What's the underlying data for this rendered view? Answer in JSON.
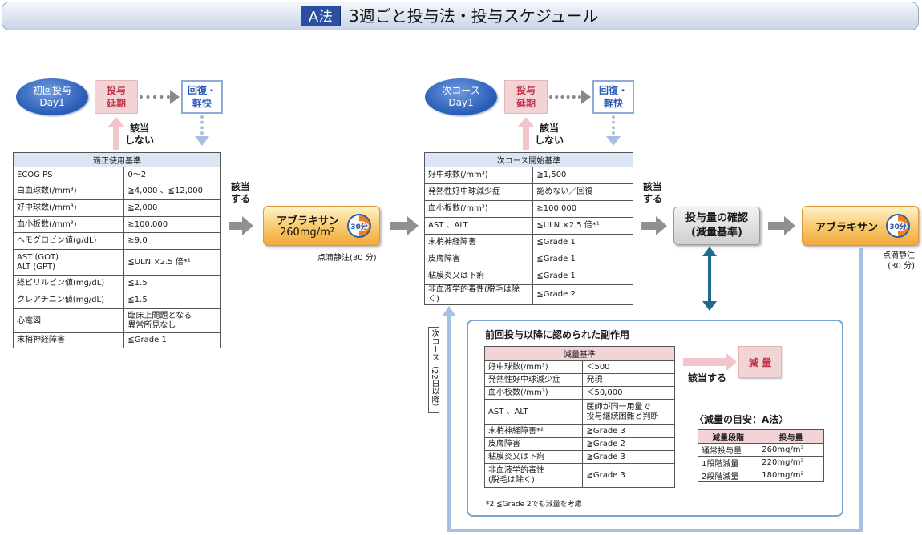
{
  "header": {
    "badge": "A法",
    "title": "3週ごと投与法・投与スケジュール"
  },
  "first": {
    "oval_line1": "初回投与",
    "oval_line2": "Day1",
    "delay_line1": "投与",
    "delay_line2": "延期",
    "recover_line1": "回復・",
    "recover_line2": "軽快",
    "no_line1": "該当",
    "no_line2": "しない",
    "table_title": "適正使用基準",
    "rows": [
      [
        "ECOG PS",
        "0～2"
      ],
      [
        "白血球数(/mm³)",
        "≧4,000 、≦12,000"
      ],
      [
        "好中球数(/mm³)",
        "≧2,000"
      ],
      [
        "血小板数(/mm³)",
        "≧100,000"
      ],
      [
        "ヘモグロビン値(g/dL)",
        "≧9.0"
      ],
      [
        "AST (GOT)\nALT (GPT)",
        "≦ULN ×2.5 倍*¹"
      ],
      [
        "総ビリルビン値(mg/dL)",
        "≦1.5"
      ],
      [
        "クレアチニン値(mg/dL)",
        "≦1.5"
      ],
      [
        "心電図",
        "臨床上問題となる\n異常所見なし"
      ],
      [
        "末梢神経障害",
        "≦Grade 1"
      ]
    ]
  },
  "yes1_line1": "該当",
  "yes1_line2": "する",
  "drug1": {
    "name": "アブラキサン",
    "dose": "260mg/m²",
    "clock": "30分",
    "note": "点滴静注(30 分)"
  },
  "next": {
    "oval_line1": "次コース",
    "oval_line2": "Day1",
    "delay_line1": "投与",
    "delay_line2": "延期",
    "recover_line1": "回復・",
    "recover_line2": "軽快",
    "no_line1": "該当",
    "no_line2": "しない",
    "table_title": "次コース開始基準",
    "rows": [
      [
        "好中球数(/mm³)",
        "≧1,500"
      ],
      [
        "発熱性好中球減少症",
        "認めない／回復"
      ],
      [
        "血小板数(/mm³)",
        "≧100,000"
      ],
      [
        "AST 、ALT",
        "≦ULN ×2.5 倍*¹"
      ],
      [
        "末梢神経障害",
        "≦Grade 1"
      ],
      [
        "皮膚障害",
        "≦Grade 1"
      ],
      [
        "粘膜炎又は下痢",
        "≦Grade 1"
      ],
      [
        "非血液学的毒性(脱毛は除く)",
        "≦Grade 2"
      ]
    ]
  },
  "yes2_line1": "該当",
  "yes2_line2": "する",
  "confirm": {
    "line1": "投与量の確認",
    "line2": "(減量基準)"
  },
  "drug2": {
    "name": "アブラキサン",
    "clock": "30分",
    "note_line1": "点滴静注",
    "note_line2": "(30 分)"
  },
  "side_tag": "次コース（22日以降）",
  "panel": {
    "title": "前回投与以降に認められた副作用",
    "table_title": "減量基準",
    "rows": [
      [
        "好中球数(/mm³)",
        "＜500"
      ],
      [
        "発熱性好中球減少症",
        "発現"
      ],
      [
        "血小板数(/mm³)",
        "＜50,000"
      ],
      [
        "AST 、ALT",
        "医師が同一用量で\n投与継続困難と判断"
      ],
      [
        "末梢神経障害*²",
        "≧Grade 3"
      ],
      [
        "皮膚障害",
        "≧Grade 2"
      ],
      [
        "粘膜炎又は下痢",
        "≧Grade 3"
      ],
      [
        "非血液学的毒性\n(脱毛は除く)",
        "≧Grade 3"
      ]
    ],
    "footnote": "*2 ≦Grade 2でも減量を考慮",
    "applies_label": "該当する",
    "reduce_label": "減 量",
    "guide_title": "〈減量の目安：A法〉",
    "guide_headers": [
      "減量段階",
      "投与量"
    ],
    "guide_rows": [
      [
        "通常投与量",
        "260mg/m²"
      ],
      [
        "1段階減量",
        "220mg/m²"
      ],
      [
        "2段階減量",
        "180mg/m²"
      ]
    ]
  }
}
